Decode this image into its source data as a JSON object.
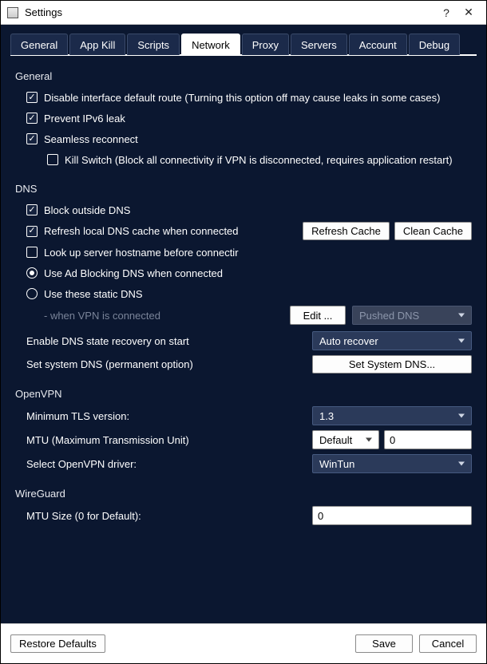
{
  "window": {
    "title": "Settings"
  },
  "tabs": [
    "General",
    "App Kill",
    "Scripts",
    "Network",
    "Proxy",
    "Servers",
    "Account",
    "Debug"
  ],
  "active_tab": "Network",
  "general": {
    "title": "General",
    "disable_default_route": {
      "checked": true,
      "label": "Disable interface default route (Turning this option off may cause leaks in some cases)"
    },
    "prevent_ipv6": {
      "checked": true,
      "label": "Prevent IPv6 leak"
    },
    "seamless_reconnect": {
      "checked": true,
      "label": "Seamless reconnect"
    },
    "kill_switch": {
      "checked": false,
      "label": "Kill Switch (Block all connectivity if VPN is disconnected, requires application restart)"
    }
  },
  "dns": {
    "title": "DNS",
    "block_outside": {
      "checked": true,
      "label": "Block outside DNS"
    },
    "refresh_local": {
      "checked": true,
      "label": "Refresh local DNS cache when connected"
    },
    "refresh_btn": "Refresh Cache",
    "clean_btn": "Clean Cache",
    "lookup_hostname": {
      "checked": false,
      "label": "Look up server hostname before connectir"
    },
    "dns_mode": {
      "selected": "adblock",
      "adblock_label": "Use Ad Blocking DNS when connected",
      "static_label": "Use these static DNS"
    },
    "static_hint": "- when VPN is connected",
    "edit_btn": "Edit ...",
    "pushed_select": "Pushed DNS",
    "state_recovery_label": "Enable DNS state recovery on start",
    "state_recovery_value": "Auto recover",
    "set_system_label": "Set system DNS (permanent option)",
    "set_system_btn": "Set System DNS..."
  },
  "openvpn": {
    "title": "OpenVPN",
    "min_tls_label": "Minimum TLS version:",
    "min_tls_value": "1.3",
    "mtu_label": "MTU (Maximum Transmission Unit)",
    "mtu_mode": "Default",
    "mtu_value": "0",
    "driver_label": "Select OpenVPN driver:",
    "driver_value": "WinTun"
  },
  "wireguard": {
    "title": "WireGuard",
    "mtu_label": "MTU Size (0 for Default):",
    "mtu_value": "0"
  },
  "footer": {
    "restore": "Restore Defaults",
    "save": "Save",
    "cancel": "Cancel"
  }
}
